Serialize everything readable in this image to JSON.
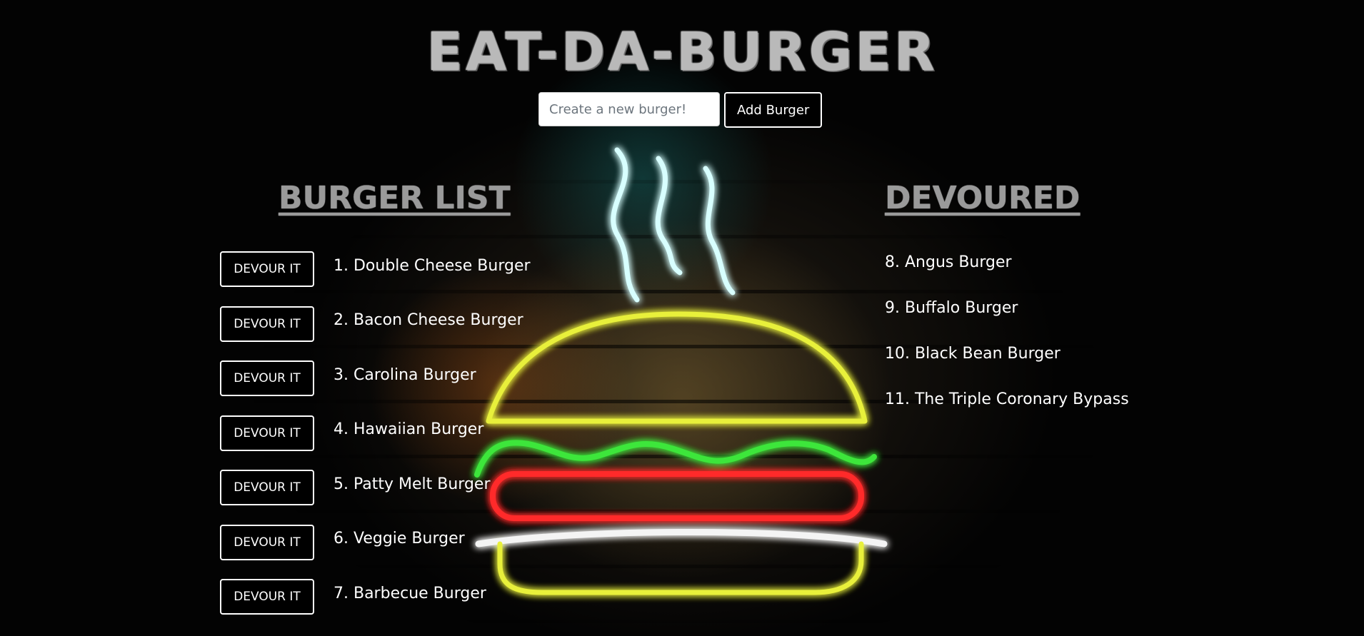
{
  "header": {
    "title": "EAT-DA-BURGER"
  },
  "form": {
    "placeholder": "Create a new burger!",
    "value": "",
    "add_label": "Add Burger"
  },
  "burger_list": {
    "heading": "BURGER LIST",
    "button_label": "DEVOUR IT",
    "items": [
      "1. Double Cheese Burger",
      "2. Bacon Cheese Burger",
      "3. Carolina Burger",
      "4. Hawaiian Burger",
      "5. Patty Melt Burger",
      "6. Veggie Burger",
      "7. Barbecue Burger"
    ]
  },
  "devoured": {
    "heading": "DEVOURED",
    "items": [
      "8. Angus Burger",
      "9. Buffalo Burger",
      "10. Black Bean Burger",
      "11. The Triple Coronary Bypass"
    ]
  },
  "colors": {
    "bun": "#e8f03a",
    "lettuce": "#3ee63a",
    "patty": "#ff2a2a",
    "cheese": "#f4f4f4",
    "steam": "#d8ffff"
  }
}
